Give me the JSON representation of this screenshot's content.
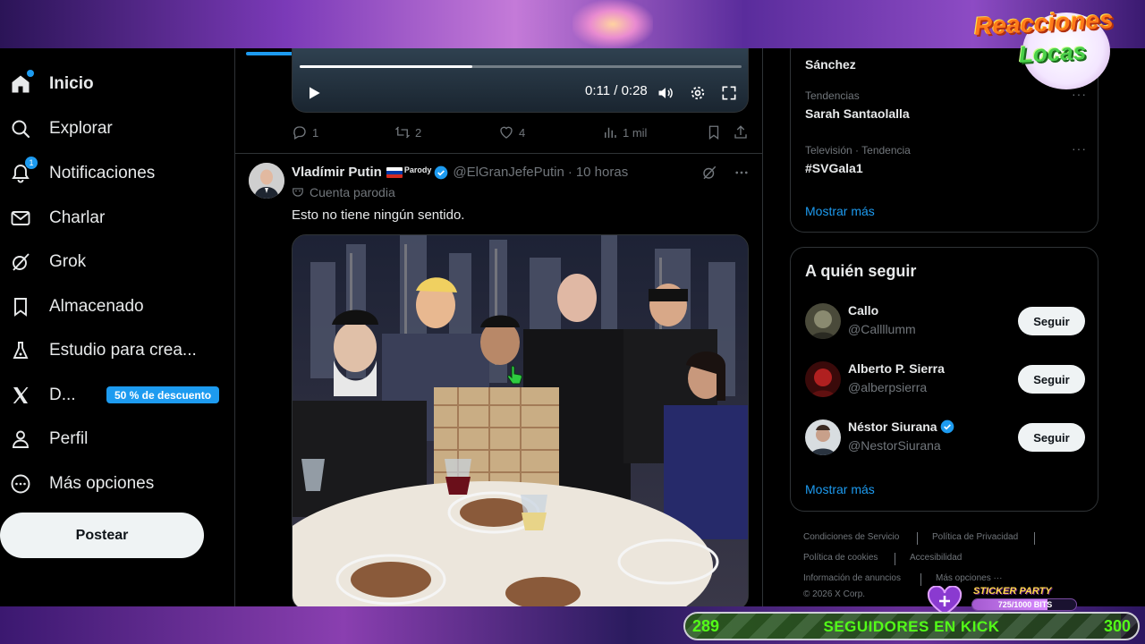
{
  "stream": {
    "logo_line1": "Reacciones",
    "logo_line2": "Locas",
    "sticker_label": "STICKER PARTY",
    "sticker_progress_text": "725/1000 BITS",
    "sticker_progress": 0.725,
    "kick_current": "289",
    "kick_label": "SEGUIDORES EN KICK",
    "kick_goal": "300",
    "kick_progress": 0.963
  },
  "sidebar": {
    "items": [
      {
        "label": "Inicio",
        "icon": "home-icon"
      },
      {
        "label": "Explorar",
        "icon": "search-icon"
      },
      {
        "label": "Notificaciones",
        "icon": "bell-icon",
        "badge": "1"
      },
      {
        "label": "Charlar",
        "icon": "mail-icon"
      },
      {
        "label": "Grok",
        "icon": "grok-icon"
      },
      {
        "label": "Almacenado",
        "icon": "bookmark-icon"
      },
      {
        "label": "Estudio para crea...",
        "icon": "flask-icon"
      },
      {
        "label": "D...",
        "icon": "x-logo-icon",
        "promo": "50 % de descuento"
      },
      {
        "label": "Perfil",
        "icon": "person-icon"
      },
      {
        "label": "Más opciones",
        "icon": "more-circle-icon"
      }
    ],
    "post_label": "Postear"
  },
  "video": {
    "time": "0:11 / 0:28",
    "progress": 0.39
  },
  "prev_actions": {
    "replies": "1",
    "reposts": "2",
    "likes": "4",
    "views": "1 mil"
  },
  "tweet": {
    "name": "Vladímir Putin",
    "parody_tag": "Parody",
    "handle": "@ElGranJefePutin",
    "sep": "·",
    "time": "10 horas",
    "parody_label": "Cuenta parodia",
    "text": "Esto no tiene ningún sentido."
  },
  "right": {
    "top_partial": "Sánchez",
    "trends": [
      {
        "meta": "Tendencias",
        "title": "Sarah Santaolalla"
      },
      {
        "meta": "Televisión · Tendencia",
        "title": "#SVGala1"
      }
    ],
    "trend_more": "Mostrar más",
    "follow_title": "A quién seguir",
    "follow": [
      {
        "name": "Callo",
        "handle": "@Callllumm",
        "button": "Seguir"
      },
      {
        "name": "Alberto P. Sierra",
        "handle": "@alberpsierra",
        "button": "Seguir"
      },
      {
        "name": "Néstor Siurana",
        "handle": "@NestorSiurana",
        "button": "Seguir",
        "verified": true
      }
    ],
    "follow_more": "Mostrar más",
    "footer": {
      "terms": "Condiciones de Servicio",
      "privacy": "Política de Privacidad",
      "cookies": "Política de cookies",
      "accessibility": "Accesibilidad",
      "ads": "Información de anuncios",
      "more": "Más opciones ···",
      "copyright": "© 2026 X Corp."
    }
  }
}
